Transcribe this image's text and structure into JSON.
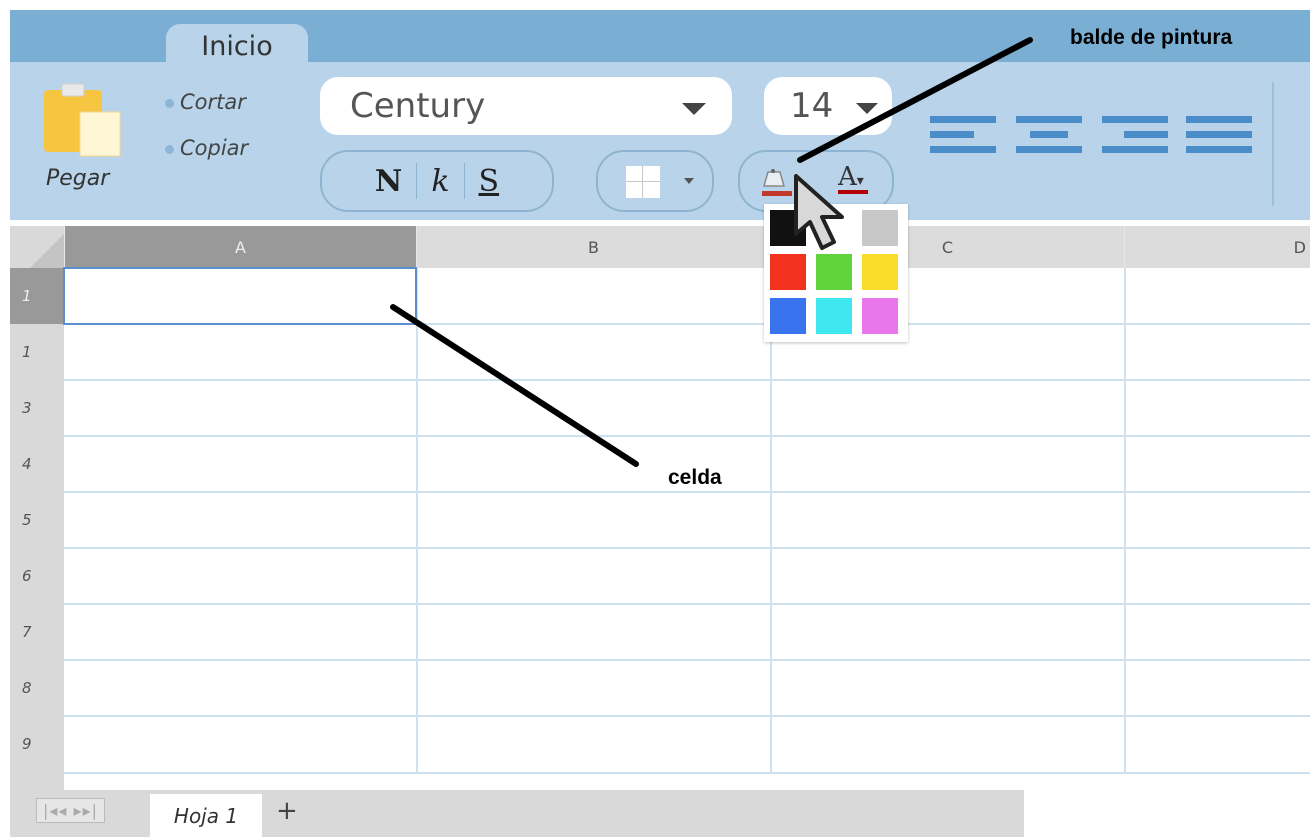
{
  "ribbon": {
    "tab_label": "Inicio",
    "paste_label": "Pegar",
    "cut_label": "Cortar",
    "copy_label": "Copiar",
    "font_name": "Century",
    "font_size": "14",
    "bold_label": "N",
    "italic_label": "k",
    "underline_label": "S",
    "font_color_label": "A"
  },
  "columns": [
    "A",
    "B",
    "C",
    "D"
  ],
  "rows": [
    "1",
    "1",
    "3",
    "4",
    "5",
    "6",
    "7",
    "8",
    "9"
  ],
  "selected_cell": "A1",
  "palette": {
    "colors": [
      "#111111",
      "#ffffff",
      "#c8c8c8",
      "#f2321e",
      "#5fd43b",
      "#fbdc2a",
      "#3a73ee",
      "#3fe8f1",
      "#e877ec"
    ]
  },
  "sheet_tabs": {
    "active": "Hoja 1",
    "add_label": "+"
  },
  "annotations": {
    "paint_bucket": "balde de pintura",
    "cell": "celda"
  },
  "colors": {
    "ribbon_bg": "#b9d4ea",
    "topbar_bg": "#7aaed3",
    "selected_header": "#999999",
    "selection_border": "#5b8fd0"
  }
}
